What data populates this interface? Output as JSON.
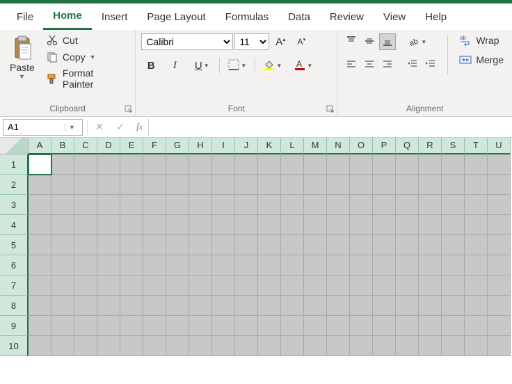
{
  "tabs": [
    "File",
    "Home",
    "Insert",
    "Page Layout",
    "Formulas",
    "Data",
    "Review",
    "View",
    "Help"
  ],
  "active_tab": "Home",
  "clipboard": {
    "paste": "Paste",
    "cut": "Cut",
    "copy": "Copy",
    "format_painter": "Format Painter",
    "group_label": "Clipboard"
  },
  "font": {
    "name": "Calibri",
    "size": "11",
    "group_label": "Font"
  },
  "alignment": {
    "wrap": "Wrap",
    "merge": "Merge",
    "group_label": "Alignment"
  },
  "name_box": "A1",
  "formula": "",
  "columns": [
    "A",
    "B",
    "C",
    "D",
    "E",
    "F",
    "G",
    "H",
    "I",
    "J",
    "K",
    "L",
    "M",
    "N",
    "O",
    "P",
    "Q",
    "R",
    "S",
    "T",
    "U"
  ],
  "rows": [
    "1",
    "2",
    "3",
    "4",
    "5",
    "6",
    "7",
    "8",
    "9",
    "10"
  ],
  "active_cell": {
    "row": 0,
    "col": 0
  }
}
